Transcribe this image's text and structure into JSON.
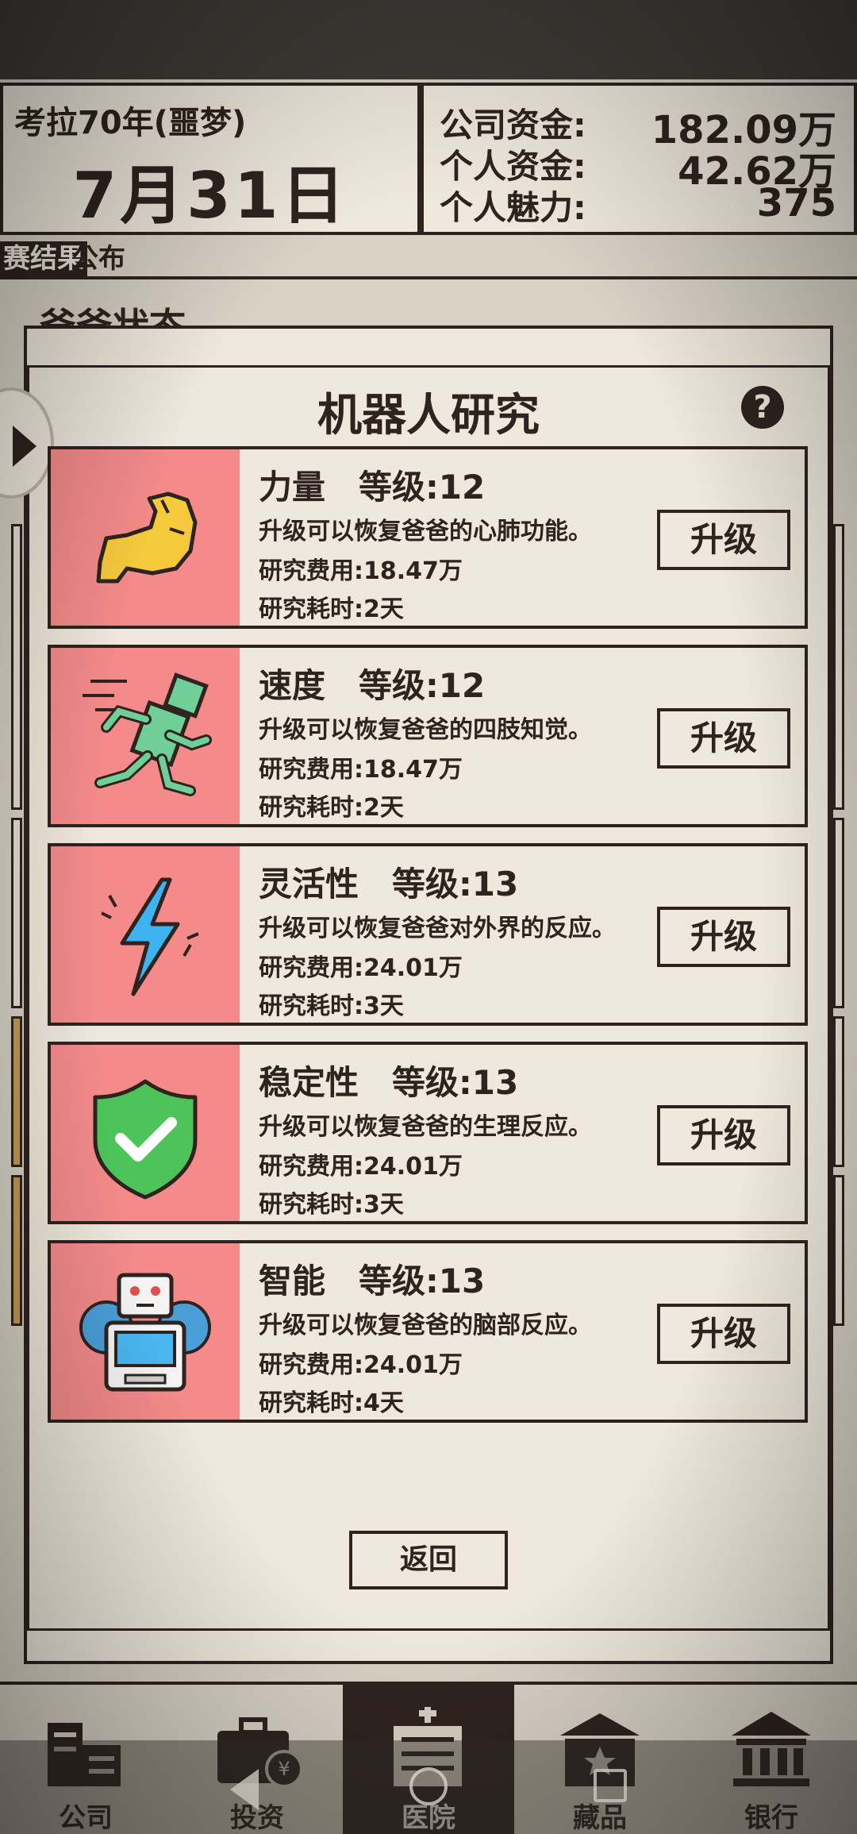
{
  "header": {
    "era": "考拉70年(噩梦)",
    "date": "7月31日",
    "stats": [
      {
        "label": "公司资金:",
        "value": "182.09万"
      },
      {
        "label": "个人资金:",
        "value": "42.62万"
      },
      {
        "label": "个人魅力:",
        "value": "375"
      }
    ]
  },
  "ticker": {
    "left": "赛结果",
    "right": "公布"
  },
  "background_title": "爸爸状态",
  "modal": {
    "title": "机器人研究",
    "help_label": "?",
    "upgrade_label": "升级",
    "back_label": "返回",
    "items": [
      {
        "name": "力量　等级:12",
        "desc": "升级可以恢复爸爸的心肺功能。",
        "cost": "研究费用:18.47万",
        "time": "研究耗时:2天",
        "icon": "muscle-arm-icon"
      },
      {
        "name": "速度　等级:12",
        "desc": "升级可以恢复爸爸的四肢知觉。",
        "cost": "研究费用:18.47万",
        "time": "研究耗时:2天",
        "icon": "running-robot-icon"
      },
      {
        "name": "灵活性　等级:13",
        "desc": "升级可以恢复爸爸对外界的反应。",
        "cost": "研究费用:24.01万",
        "time": "研究耗时:3天",
        "icon": "lightning-bolt-icon"
      },
      {
        "name": "稳定性　等级:13",
        "desc": "升级可以恢复爸爸的生理反应。",
        "cost": "研究费用:24.01万",
        "time": "研究耗时:3天",
        "icon": "shield-check-icon"
      },
      {
        "name": "智能　等级:13",
        "desc": "升级可以恢复爸爸的脑部反应。",
        "cost": "研究费用:24.01万",
        "time": "研究耗时:4天",
        "icon": "robot-gear-icon"
      }
    ]
  },
  "nav": [
    {
      "label": "公司",
      "icon": "company-buildings-icon",
      "active": false
    },
    {
      "label": "投资",
      "icon": "briefcase-yen-icon",
      "active": false
    },
    {
      "label": "医院",
      "icon": "hospital-icon",
      "active": true
    },
    {
      "label": "藏品",
      "icon": "museum-star-icon",
      "active": false
    },
    {
      "label": "银行",
      "icon": "bank-icon",
      "active": false
    }
  ],
  "colors": {
    "ink": "#2e231f",
    "paper": "#efe8dc",
    "thumb": "#f48a8a"
  }
}
